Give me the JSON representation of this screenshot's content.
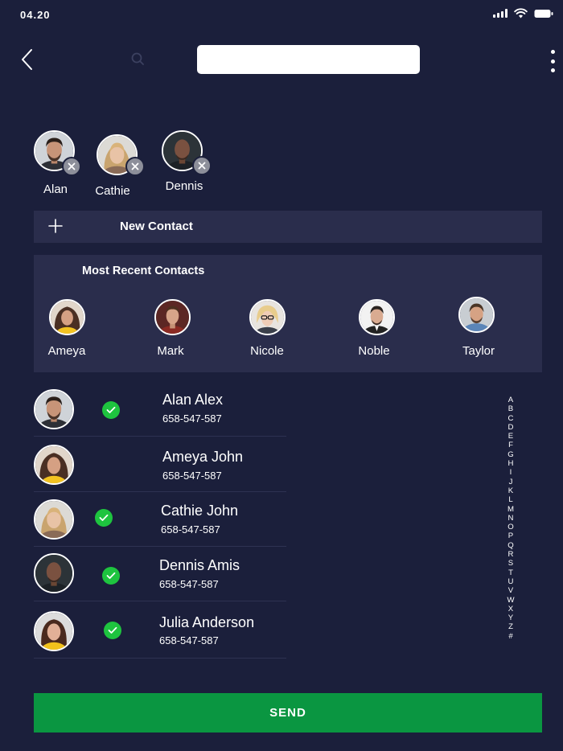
{
  "status_bar": {
    "time": "04.20"
  },
  "search": {
    "placeholder": "",
    "value": ""
  },
  "selected_contacts": [
    {
      "name": "Alan",
      "icon": "remove-icon"
    },
    {
      "name": "Cathie",
      "icon": "remove-icon"
    },
    {
      "name": "Dennis",
      "icon": "remove-icon"
    }
  ],
  "new_contact": {
    "label": "New Contact",
    "icon": "plus-icon"
  },
  "recent": {
    "title": "Most Recent Contacts",
    "items": [
      {
        "name": "Ameya"
      },
      {
        "name": "Mark"
      },
      {
        "name": "Nicole"
      },
      {
        "name": "Noble"
      },
      {
        "name": "Taylor"
      }
    ]
  },
  "contacts": [
    {
      "name": "Alan Alex",
      "phone": "658-547-587",
      "selected": true
    },
    {
      "name": "Ameya John",
      "phone": "658-547-587",
      "selected": false
    },
    {
      "name": "Cathie John",
      "phone": "658-547-587",
      "selected": true
    },
    {
      "name": "Dennis Amis",
      "phone": "658-547-587",
      "selected": true
    },
    {
      "name": "Julia Anderson",
      "phone": "658-547-587",
      "selected": true
    }
  ],
  "alphabet_index": [
    "A",
    "B",
    "C",
    "D",
    "E",
    "F",
    "G",
    "H",
    "I",
    "J",
    "K",
    "L",
    "M",
    "N",
    "O",
    "P",
    "Q",
    "R",
    "S",
    "T",
    "U",
    "V",
    "W",
    "X",
    "Y",
    "Z",
    "#"
  ],
  "send_button": {
    "label": "SEND"
  },
  "colors": {
    "background": "#1b1f3b",
    "panel": "#2a2d4c",
    "check": "#1ec43f",
    "send": "#0a9641",
    "remove_badge": "#8d8f9a"
  }
}
